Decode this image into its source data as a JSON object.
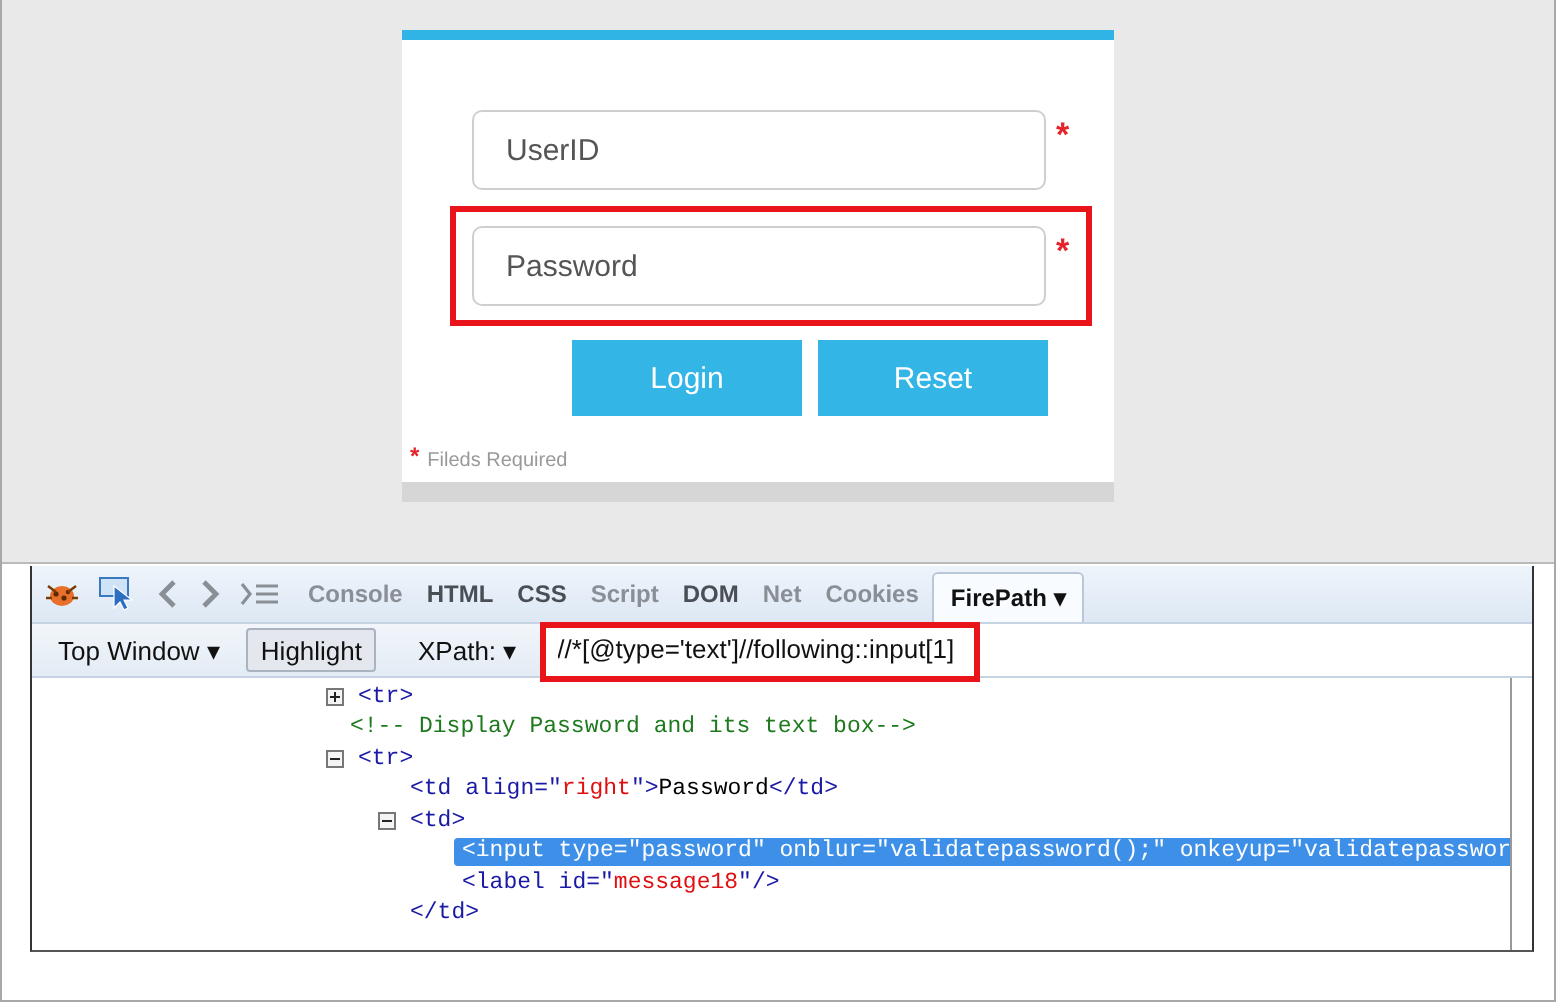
{
  "login_form": {
    "fields": [
      {
        "placeholder": "UserID",
        "required_mark": "*",
        "highlighted": false
      },
      {
        "placeholder": "Password",
        "required_mark": "*",
        "highlighted": true
      }
    ],
    "buttons": [
      "Login",
      "Reset"
    ],
    "footnote": {
      "mark": "*",
      "text": "Fileds Required"
    }
  },
  "devtools": {
    "tabs": [
      {
        "label": "Console",
        "disabled": true,
        "selected": false
      },
      {
        "label": "HTML",
        "disabled": false,
        "selected": false
      },
      {
        "label": "CSS",
        "disabled": false,
        "selected": false
      },
      {
        "label": "Script",
        "disabled": true,
        "selected": false
      },
      {
        "label": "DOM",
        "disabled": false,
        "selected": false
      },
      {
        "label": "Net",
        "disabled": true,
        "selected": false
      },
      {
        "label": "Cookies",
        "disabled": true,
        "selected": false
      },
      {
        "label": "FirePath",
        "disabled": false,
        "selected": true,
        "dropdown": "▾"
      }
    ],
    "toolbar": {
      "frame_menu": {
        "label": "Top Window",
        "arrow": "▾"
      },
      "highlight_button": {
        "label": "Highlight",
        "pressed": true
      },
      "xpath_menu": {
        "label": "XPath:",
        "arrow": "▾"
      },
      "xpath_field": {
        "value": "//*[@type='text']//following::input[1]",
        "highlighted": true
      }
    },
    "tree": [
      {
        "expanded": false,
        "selected": false,
        "tokens": [
          {
            "kind": "tag",
            "text": "<tr>"
          }
        ]
      },
      {
        "selected": false,
        "tokens": [
          {
            "kind": "comment",
            "text": "<!-- Display Password and its text box-->"
          }
        ]
      },
      {
        "expanded": true,
        "selected": false,
        "tokens": [
          {
            "kind": "tag",
            "text": "<tr>"
          }
        ],
        "children": [
          {
            "selected": false,
            "tokens": [
              {
                "kind": "tag",
                "text": "<td align=\""
              },
              {
                "kind": "value",
                "text": "right"
              },
              {
                "kind": "tag",
                "text": "\">"
              },
              {
                "kind": "text",
                "text": "Password"
              },
              {
                "kind": "tag",
                "text": "</td>"
              }
            ]
          },
          {
            "expanded": true,
            "selected": false,
            "tokens": [
              {
                "kind": "tag",
                "text": "<td>"
              }
            ],
            "closing": [
              {
                "kind": "tag",
                "text": "</td>"
              }
            ],
            "children": [
              {
                "selected": true,
                "tokens": [
                  {
                    "kind": "tag",
                    "text": "<input type=\""
                  },
                  {
                    "kind": "value",
                    "text": "password"
                  },
                  {
                    "kind": "tag",
                    "text": "\" onblur=\""
                  },
                  {
                    "kind": "value",
                    "text": "validatepassword();"
                  },
                  {
                    "kind": "tag",
                    "text": "\" onkeyup=\""
                  },
                  {
                    "kind": "value",
                    "text": "validatepasswor"
                  }
                ]
              },
              {
                "selected": false,
                "tokens": [
                  {
                    "kind": "tag",
                    "text": "<label id=\""
                  },
                  {
                    "kind": "value",
                    "text": "message18"
                  },
                  {
                    "kind": "tag",
                    "text": "\"/>"
                  }
                ]
              }
            ]
          }
        ]
      }
    ]
  }
}
